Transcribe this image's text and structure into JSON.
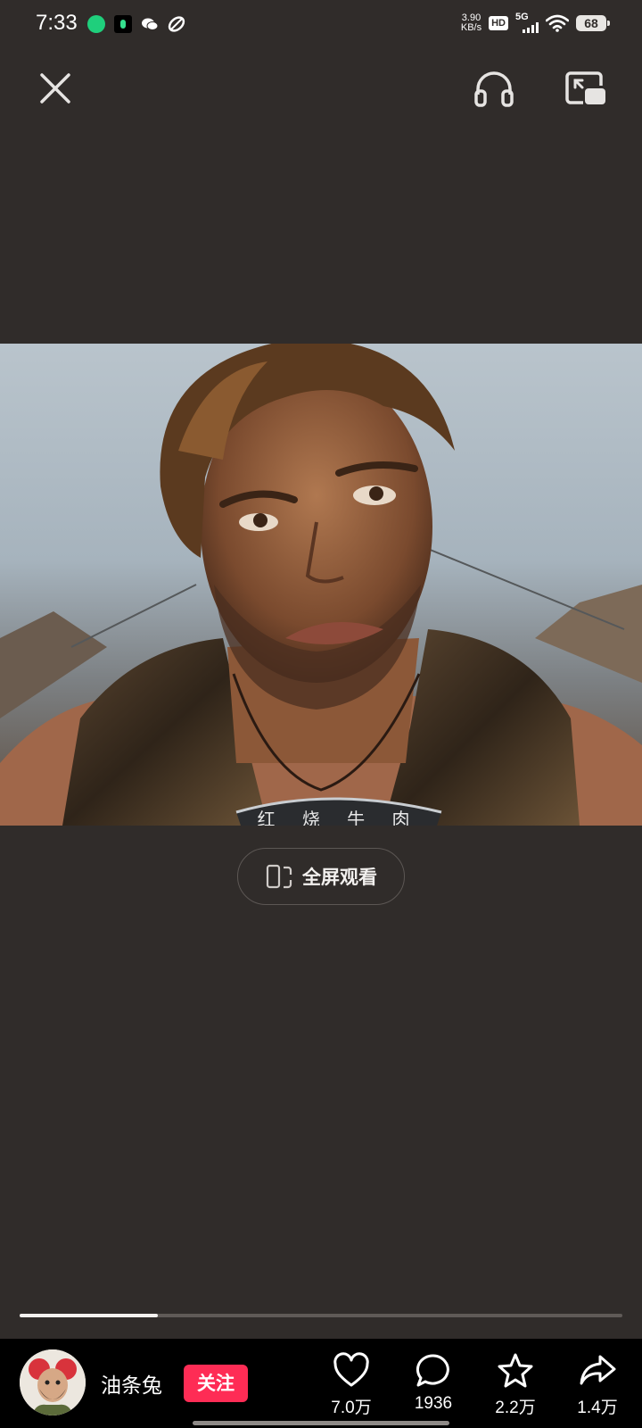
{
  "status_bar": {
    "time": "7:33",
    "net_speed_value": "3.90",
    "net_speed_unit": "KB/s",
    "hd_badge": "HD",
    "network": "5G",
    "battery": "68"
  },
  "top_bar": {
    "close_icon": "close-icon",
    "listen_icon": "headphones-icon",
    "pip_icon": "picture-in-picture-icon"
  },
  "video": {
    "caption_partial": "红 烧 牛 肉"
  },
  "fullscreen": {
    "label": "全屏观看",
    "icon": "rotate-phone-icon"
  },
  "progress": {
    "fraction": 0.23
  },
  "author": {
    "name": "油条兔",
    "follow_label": "关注"
  },
  "actions": {
    "likes": "7.0万",
    "comments": "1936",
    "favorites": "2.2万",
    "shares": "1.4万"
  },
  "colors": {
    "background": "#302c2a",
    "follow": "#fe2c55"
  }
}
